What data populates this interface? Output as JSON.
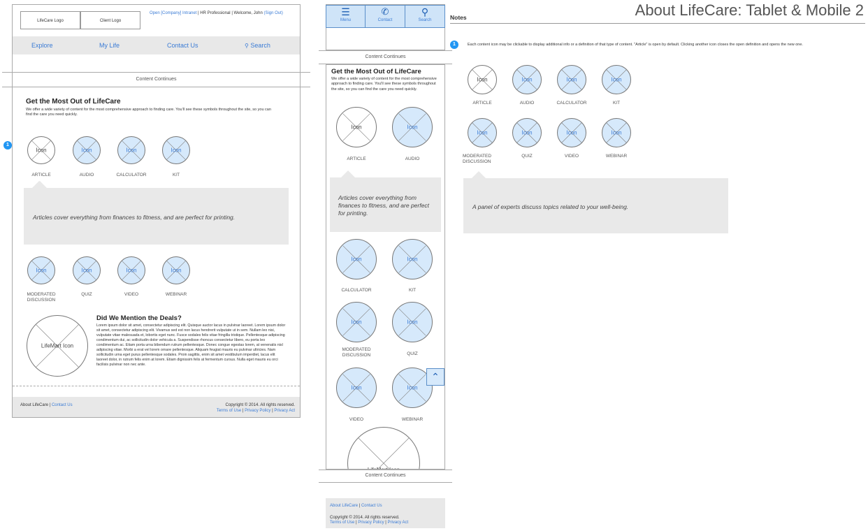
{
  "page_title": "About LifeCare: Tablet & Mobile 2",
  "desktop": {
    "lifecare_logo": "LifeCare Logo",
    "client_logo": "Client Logo",
    "utility": {
      "intranet": "Open [Company] Intranet",
      "sep1": "|",
      "role": "HR Professional",
      "sep2": "|",
      "welcome": "Welcome, John",
      "signout": "(Sign Out)"
    },
    "nav": {
      "explore": "Explore",
      "mylife": "My Life",
      "contact": "Contact Us",
      "search": "Search"
    },
    "content_continues": "Content Continues",
    "heading": "Get the Most Out of LifeCare",
    "intro": "We offer a wide variety of content for the most comprehensive approach to finding care. You'll see these symbols throughout the site, so you can find the care you need quickly.",
    "icon_text": "Icon",
    "icons_row1": [
      "ARTICLE",
      "AUDIO",
      "CALCULATOR",
      "KIT"
    ],
    "callout": "Articles cover everything from finances to fitness, and are perfect for printing.",
    "icons_row2": [
      "MODERATED DISCUSSION",
      "QUIZ",
      "VIDEO",
      "WEBINAR"
    ],
    "lifemart_icon": "LifeMart Icon",
    "deals_heading": "Did We Mention the Deals?",
    "deals_body": "Lorem ipsum dolor sit amet, consectetur adipiscing elit. Quisque auctor lacus in pulvinar laoreet. Lorem ipsum dolor sit amet, consectetur adipiscing elit. Vivamus sed est non lacus hendrerit vulputate ut in sem. Nullam leo nisi, vulputate vitae malesuada et, lobortis eget nunc. Fusce sodales felis vitae fringilla tristique. Pellentesque adipiscing condimentum dui, ac sollicitudin dolor vehicula a. Suspendisse rhoncus consectetur libero, eu porta leo condimentum ac. Etiam porta urna bibendum rutrum pellentesque. Donec congue egestas lorem, at venenatis nisl adipiscing vitae. Morbi a erat vel lorem ornare pellentesque. Aliquam feugiat mauris eu pulvinar ultricies. Nam sollicitudin urna eget purus pellentesque sodales. Proin sagittis, enim sit amet vestibulum imperdiet, lacus elit laoreet dolor, in rutrum felis enim at lorem. Etiam dignissim felis at fermentum cursus. Nulla eget mauris eu orci facilisis pulvinar non nec ante.",
    "footer": {
      "about": "About LifeCare",
      "sep": "|",
      "contact": "Contact Us",
      "copyright": "Copyright © 2014. All rights reserved.",
      "terms": "Terms of Use",
      "privacy_policy": "Privacy Policy",
      "privacy_act": "Privacy Act"
    }
  },
  "mobile": {
    "tabs": {
      "menu": "Menu",
      "contact": "Contact",
      "search": "Search"
    },
    "content_continues": "Content Continues",
    "heading": "Get the Most Out of LifeCare",
    "intro": "We offer a wide variety of content for the most comprehensive approach to finding care. You'll see these symbols throughout the site, so you can find the care you need quickly.",
    "icon_text": "Icon",
    "captions": [
      "ARTICLE",
      "AUDIO",
      "CALCULATOR",
      "KIT",
      "MODERATED DISCUSSION",
      "QUIZ",
      "VIDEO",
      "WEBINAR"
    ],
    "callout": "Articles cover everything from finances to fitness, and are perfect for printing.",
    "lifemart_icon": "LifeMart Icon",
    "content_continues_2": "Content Continues",
    "footer": {
      "about": "About LifeCare",
      "sep": "|",
      "contact": "Contact Us",
      "copyright": "Copyright © 2014. All rights reserved.",
      "terms": "Terms of Use",
      "privacy_policy": "Privacy Policy",
      "privacy_act": "Privacy Act"
    }
  },
  "notes": {
    "title": "Notes",
    "badge": "1",
    "text": "Each content icon may be clickable to display additional info or a definition of that type of content. \"Article\" is open by default. Clicking another icon closes the open definition and opens the new one.",
    "icon_text": "Icon",
    "icons_row1": [
      "ARTICLE",
      "AUDIO",
      "CALCULATOR",
      "KIT"
    ],
    "icons_row2": [
      "MODERATED DISCUSSION",
      "QUIZ",
      "VIDEO",
      "WEBINAR"
    ],
    "callout": "A panel of experts discuss topics related to your well-being."
  },
  "colors": {
    "accent": "#3a7bd5",
    "icon_fill": "#d6e9fb",
    "tab_fill": "#cfe4f8",
    "badge": "#2196f3",
    "panel_gray": "#e9e9e9"
  }
}
